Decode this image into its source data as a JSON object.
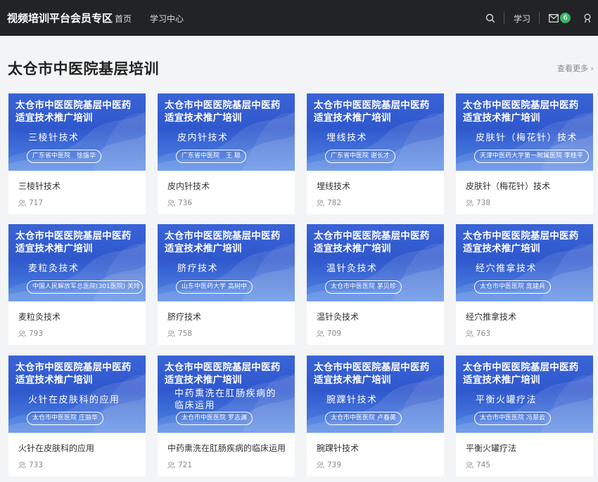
{
  "header": {
    "brand": "视频培训平台会员专区",
    "nav_home": "首页",
    "nav_learn": "学习中心",
    "study_link": "学习",
    "mail_count": "6",
    "icons": [
      "search-icon",
      "mail-icon",
      "user-icon"
    ]
  },
  "section": {
    "title": "太仓市中医院基层培训",
    "more": "查看更多 ›"
  },
  "banner_heading_line1": "太仓市中医医院基层中医药",
  "banner_heading_line2": "适宜技术推广培训",
  "cards": [
    {
      "sub": "三棱针技术",
      "pill": "广东省中医院　徐振华",
      "title": "三棱针技术",
      "views": "717"
    },
    {
      "sub": "皮内针技术",
      "pill": "广东省中医院　王 聪",
      "title": "皮内针技术",
      "views": "736"
    },
    {
      "sub": "埋线技术",
      "pill": "广东省中医院  谢长才",
      "title": "埋线技术",
      "views": "782"
    },
    {
      "sub": "皮肤针（梅花针）技术",
      "pill": "天津中医药大学第一附属医院  李桂平",
      "title": "皮肤针（梅花针）技术",
      "views": "738"
    },
    {
      "sub": "麦粒灸技术",
      "pill": "中国人民解放军总医院(301医院) 关玲",
      "title": "麦粒灸技术",
      "views": "793"
    },
    {
      "sub": "脐疗技术",
      "pill": "山东中医药大学  高树中",
      "title": "脐疗技术",
      "views": "758"
    },
    {
      "sub": "温针灸技术",
      "pill": "太仓市中医医院  茅贝珍",
      "title": "温针灸技术",
      "views": "709"
    },
    {
      "sub": "经穴推拿技术",
      "pill": "太仓市中医医院  庞建兵",
      "title": "经穴推拿技术",
      "views": "763"
    },
    {
      "sub": "火针在皮肤科的应用",
      "pill": "太仓市中医医院  庄丽华",
      "title": "火针在皮肤科的应用",
      "views": "733"
    },
    {
      "sub": "中药熏洗在肛肠疾病的",
      "sub2": "临床运用",
      "pill": "太仓市中医医院  罗志渊",
      "title": "中药熏洗在肛肠疾病的临床运用",
      "views": "721"
    },
    {
      "sub": "腕踝针技术",
      "pill": "太仓市中医医院  卢春英",
      "title": "腕踝针技术",
      "views": "739"
    },
    {
      "sub": "平衡火罐疗法",
      "pill": "太仓市中医医院  冯翠云",
      "title": "平衡火罐疗法",
      "views": "745"
    }
  ]
}
